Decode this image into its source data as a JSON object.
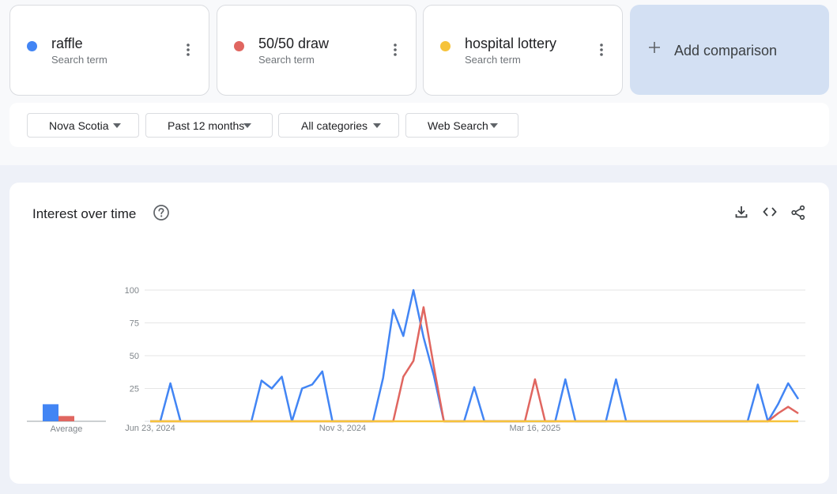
{
  "terms": [
    {
      "name": "raffle",
      "sub": "Search term",
      "color": "#4285f4"
    },
    {
      "name": "50/50 draw",
      "sub": "Search term",
      "color": "#e06660"
    },
    {
      "name": "hospital lottery",
      "sub": "Search term",
      "color": "#f6c33b"
    }
  ],
  "add_comparison": "Add comparison",
  "filters": {
    "region": "Nova Scotia",
    "time": "Past 12 months",
    "category": "All categories",
    "search_type": "Web Search"
  },
  "chart_card": {
    "title": "Interest over time",
    "icons": [
      "help-icon",
      "download-icon",
      "embed-icon",
      "share-icon"
    ]
  },
  "chart_data": {
    "type": "line",
    "ylim": [
      0,
      100
    ],
    "yticks": [
      25,
      50,
      75,
      100
    ],
    "x_tick_labels": [
      "Jun 23, 2024",
      "Nov 3, 2024",
      "Mar 16, 2025"
    ],
    "x_tick_index": [
      0,
      19,
      38
    ],
    "grid": true,
    "average_label": "Average",
    "averages": [
      {
        "name": "raffle",
        "value": 13,
        "color": "#4285f4"
      },
      {
        "name": "50/50 draw",
        "value": 4,
        "color": "#e06660"
      },
      {
        "name": "hospital lottery",
        "value": 0,
        "color": "#f6c33b"
      }
    ],
    "series": [
      {
        "name": "raffle",
        "color": "#4285f4",
        "values": [
          0,
          0,
          29,
          0,
          0,
          0,
          0,
          0,
          0,
          0,
          0,
          31,
          25,
          34,
          0,
          25,
          28,
          38,
          0,
          0,
          0,
          0,
          0,
          33,
          85,
          65,
          100,
          64,
          35,
          0,
          0,
          0,
          26,
          0,
          0,
          0,
          0,
          0,
          0,
          0,
          0,
          32,
          0,
          0,
          0,
          0,
          32,
          0,
          0,
          0,
          0,
          0,
          0,
          0,
          0,
          0,
          0,
          0,
          0,
          0,
          28,
          0,
          13,
          29,
          17
        ]
      },
      {
        "name": "50/50 draw",
        "color": "#e06660",
        "values": [
          0,
          0,
          0,
          0,
          0,
          0,
          0,
          0,
          0,
          0,
          0,
          0,
          0,
          0,
          0,
          0,
          0,
          0,
          0,
          0,
          0,
          0,
          0,
          0,
          0,
          34,
          46,
          87,
          42,
          0,
          0,
          0,
          0,
          0,
          0,
          0,
          0,
          0,
          32,
          0,
          0,
          0,
          0,
          0,
          0,
          0,
          0,
          0,
          0,
          0,
          0,
          0,
          0,
          0,
          0,
          0,
          0,
          0,
          0,
          0,
          0,
          0,
          6,
          11,
          6
        ]
      },
      {
        "name": "hospital lottery",
        "color": "#f6c33b",
        "values": [
          0,
          0,
          0,
          0,
          0,
          0,
          0,
          0,
          0,
          0,
          0,
          0,
          0,
          0,
          0,
          0,
          0,
          0,
          0,
          0,
          0,
          0,
          0,
          0,
          0,
          0,
          0,
          0,
          0,
          0,
          0,
          0,
          0,
          0,
          0,
          0,
          0,
          0,
          0,
          0,
          0,
          0,
          0,
          0,
          0,
          0,
          0,
          0,
          0,
          0,
          0,
          0,
          0,
          0,
          0,
          0,
          0,
          0,
          0,
          0,
          0,
          0,
          0,
          0,
          0
        ]
      }
    ]
  }
}
